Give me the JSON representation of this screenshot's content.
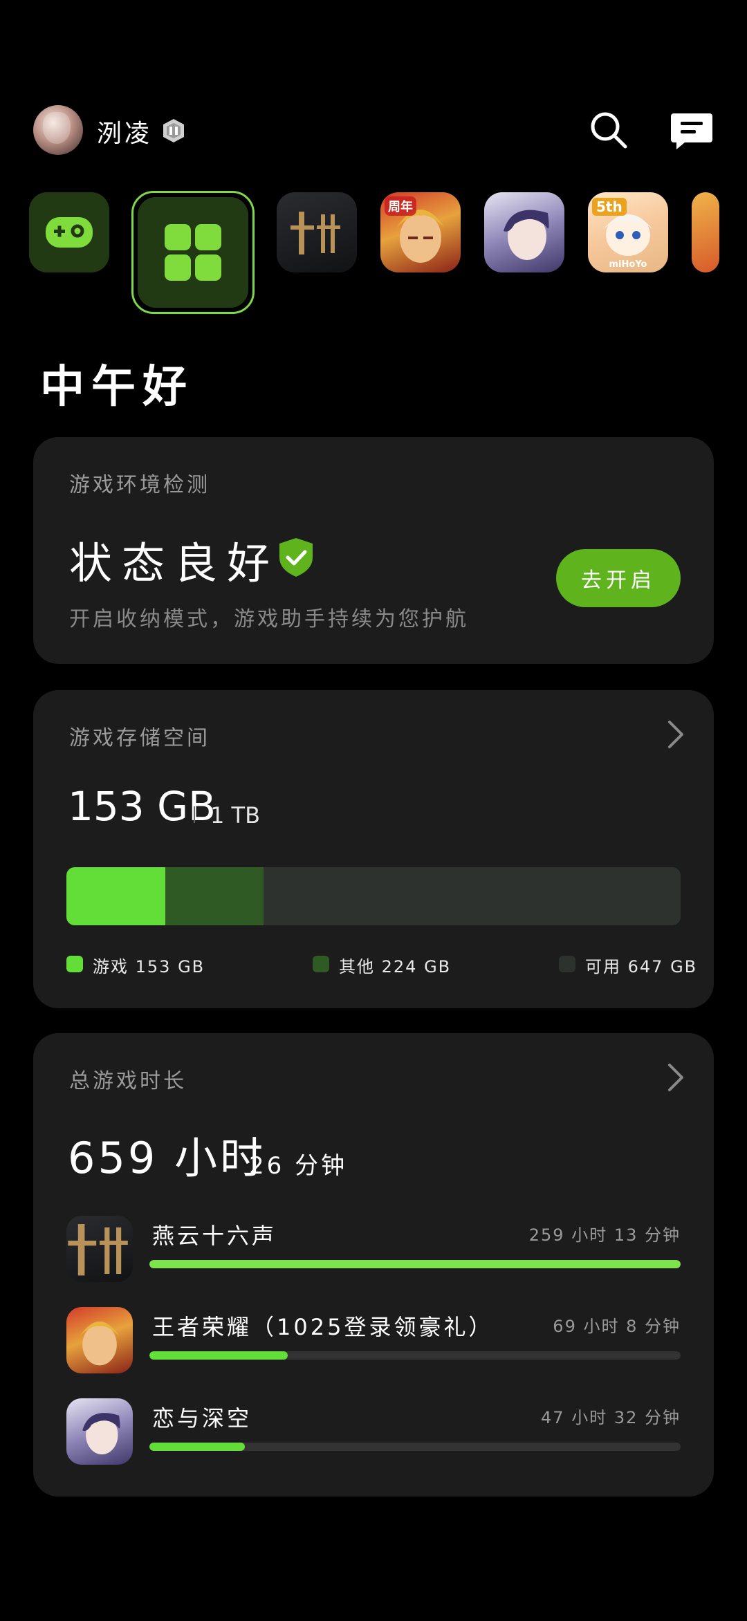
{
  "user": {
    "name": "洌凌",
    "avatar_icon": "user-avatar",
    "badge_icon": "level-badge-icon"
  },
  "header": {
    "search_icon": "search-icon",
    "message_icon": "message-icon"
  },
  "app_strip": {
    "items": [
      {
        "name": "game-center",
        "icon": "gamepad-icon"
      },
      {
        "name": "all-apps",
        "icon": "grid-icon",
        "selected": true
      },
      {
        "name": "燕云十六声"
      },
      {
        "name": "王者荣耀",
        "badge": "周年"
      },
      {
        "name": "恋与深空"
      },
      {
        "name": "原神",
        "badge": "5th",
        "footer": "miHoYo"
      },
      {
        "name": "partial-game"
      }
    ]
  },
  "greeting": "中午好",
  "env_card": {
    "title": "游戏环境检测",
    "status": "状态良好",
    "description": "开启收纳模式，游戏助手持续为您护航",
    "button": "去开启",
    "accent": "#5fb31c"
  },
  "storage_card": {
    "title": "游戏存储空间",
    "used": "153 GB",
    "total": "1 TB",
    "breakdown": {
      "games_fraction": 0.1607,
      "other_fraction": 0.1607
    },
    "legend": [
      {
        "label": "游戏 153 GB",
        "color": "#63dd38"
      },
      {
        "label": "其他 224 GB",
        "color": "#2f5a24"
      },
      {
        "label": "可用 647 GB",
        "color": "#2e322e"
      }
    ]
  },
  "playtime_card": {
    "title": "总游戏时长",
    "hours": "659 小时",
    "minutes": "26 分钟",
    "games": [
      {
        "name": "燕云十六声",
        "time": "259 小时 13 分钟",
        "fraction": 1.0,
        "bar_color": "#7fe34d"
      },
      {
        "name": "王者荣耀（1025登录领豪礼）",
        "time": "69 小时 8 分钟",
        "fraction": 0.26
      },
      {
        "name": "恋与深空",
        "time": "47 小时 32 分钟",
        "fraction": 0.18
      }
    ]
  }
}
